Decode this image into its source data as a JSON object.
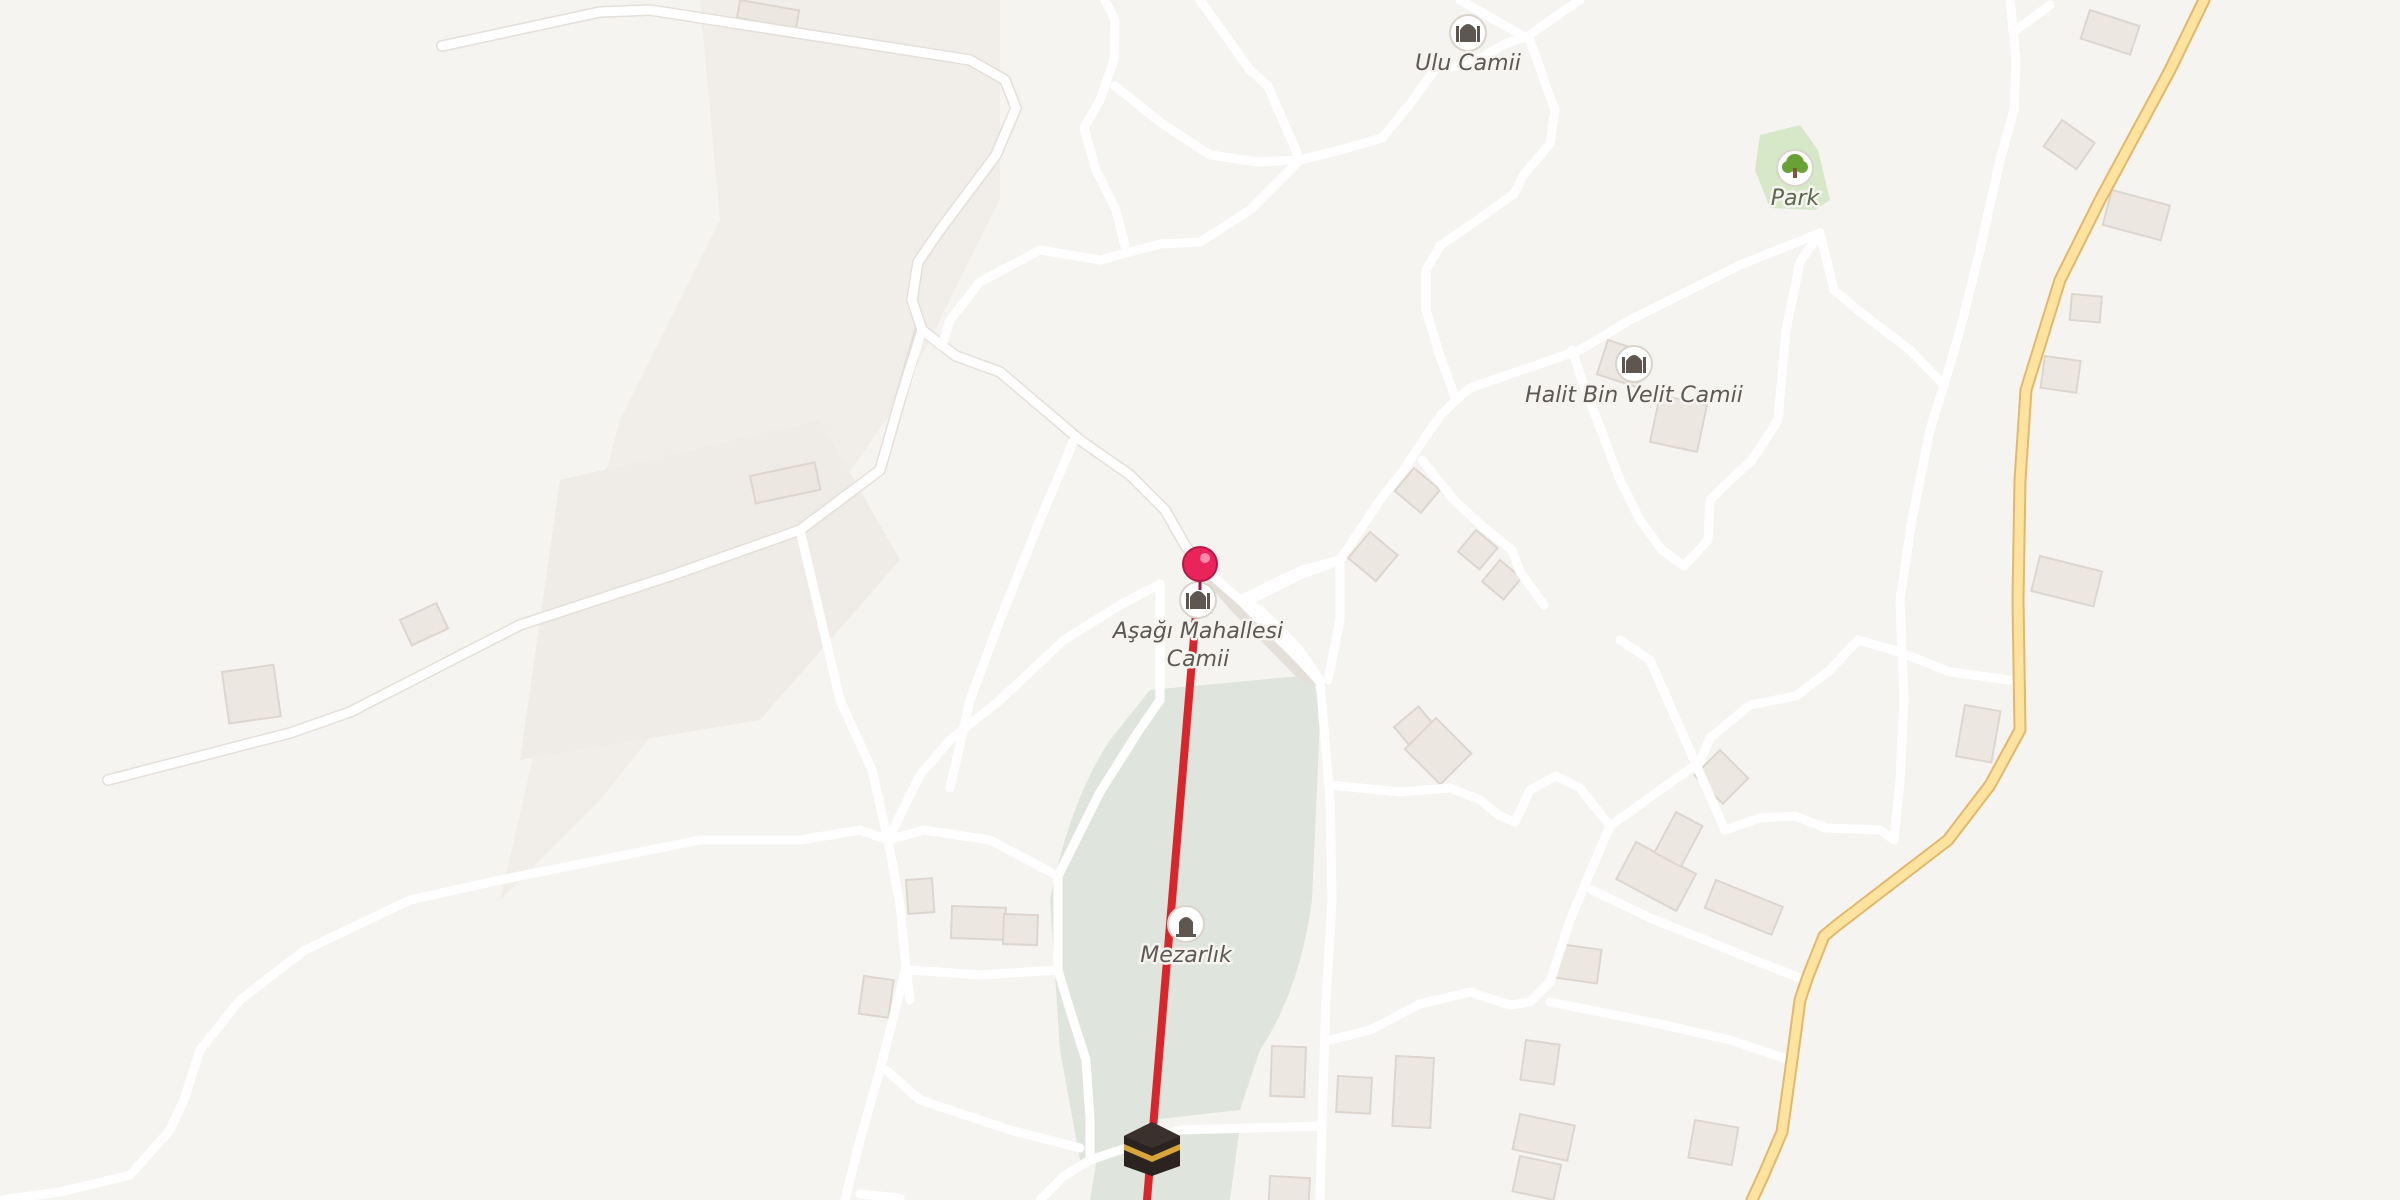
{
  "map": {
    "pois": [
      {
        "id": "ulu-camii",
        "label": "Ulu Camii",
        "icon": "mosque-icon"
      },
      {
        "id": "halit-bin-velit-camii",
        "label": "Halit Bin Velit Camii",
        "icon": "mosque-icon"
      },
      {
        "id": "park",
        "label": "Park",
        "icon": "tree-icon"
      },
      {
        "id": "asagi-mahallesi-camii",
        "label_line1": "Aşağı Mahallesi",
        "label_line2": "Camii",
        "icon": "mosque-icon"
      },
      {
        "id": "mezarlik",
        "label": "Mezarlık",
        "icon": "grave-icon"
      }
    ],
    "marker": {
      "icon": "location-pin-icon",
      "color": "#e8245a"
    },
    "qibla_line": {
      "color": "#d9262c"
    },
    "kaaba": {
      "icon": "kaaba-icon"
    },
    "colors": {
      "background": "#f6f4f1",
      "road": "#ffffff",
      "main_road": "#fde3a0",
      "cemetery": "#dfe4dc",
      "park": "#d6e8c8",
      "building": "#ece7e1"
    }
  }
}
